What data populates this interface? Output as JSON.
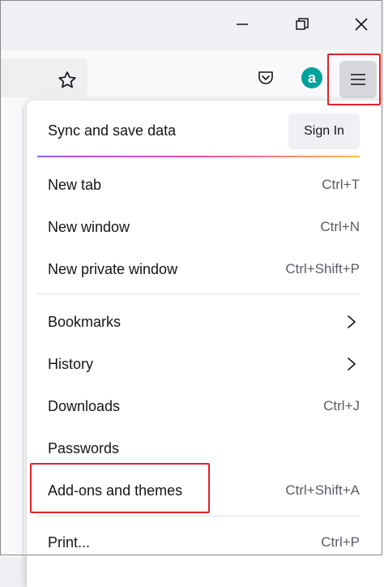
{
  "window": {
    "minimize_icon": "minimize-icon",
    "restore_icon": "restore-icon",
    "close_icon": "close-icon"
  },
  "toolbar": {
    "bookmark_icon": "star-icon",
    "pocket_icon": "pocket-icon",
    "extension_icon": "amazon-assistant-icon",
    "menu_icon": "hamburger-menu-icon"
  },
  "menu": {
    "sync_label": "Sync and save data",
    "sign_in_label": "Sign In",
    "items": [
      {
        "label": "New tab",
        "shortcut": "Ctrl+T"
      },
      {
        "label": "New window",
        "shortcut": "Ctrl+N"
      },
      {
        "label": "New private window",
        "shortcut": "Ctrl+Shift+P"
      },
      {
        "label": "Bookmarks",
        "shortcut": ""
      },
      {
        "label": "History",
        "shortcut": ""
      },
      {
        "label": "Downloads",
        "shortcut": "Ctrl+J"
      },
      {
        "label": "Passwords",
        "shortcut": ""
      },
      {
        "label": "Add-ons and themes",
        "shortcut": "Ctrl+Shift+A"
      },
      {
        "label": "Print...",
        "shortcut": "Ctrl+P"
      }
    ]
  },
  "colors": {
    "highlight": "#e02229",
    "amazon_green": "#00a19a",
    "accent_gradient": [
      "#9059ff",
      "#ff4aa2",
      "#ffbd4f"
    ]
  }
}
